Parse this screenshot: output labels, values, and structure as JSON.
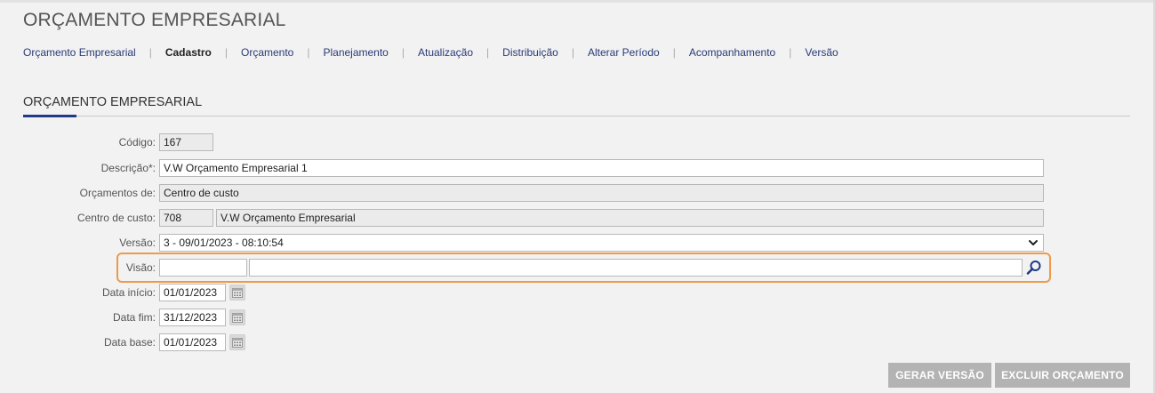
{
  "app": {
    "title": "ORÇAMENTO EMPRESARIAL"
  },
  "menu": {
    "items": [
      {
        "label": "Orçamento Empresarial",
        "active": false
      },
      {
        "label": "Cadastro",
        "active": true
      },
      {
        "label": "Orçamento",
        "active": false
      },
      {
        "label": "Planejamento",
        "active": false
      },
      {
        "label": "Atualização",
        "active": false
      },
      {
        "label": "Distribuição",
        "active": false
      },
      {
        "label": "Alterar Período",
        "active": false
      },
      {
        "label": "Acompanhamento",
        "active": false
      },
      {
        "label": "Versão",
        "active": false
      }
    ],
    "separator": "|"
  },
  "section": {
    "title": "ORÇAMENTO EMPRESARIAL"
  },
  "form": {
    "codigo": {
      "label": "Código:",
      "value": "167"
    },
    "descricao": {
      "label": "Descrição*:",
      "value": "V.W Orçamento Empresarial 1"
    },
    "orcamentos_de": {
      "label": "Orçamentos de:",
      "value": "Centro de custo"
    },
    "centro_custo": {
      "label": "Centro de custo:",
      "code": "708",
      "name": "V.W Orçamento Empresarial"
    },
    "versao": {
      "label": "Versão:",
      "value": "3 - 09/01/2023 - 08:10:54"
    },
    "visao": {
      "label": "Visão:",
      "code": "",
      "name": ""
    },
    "data_inicio": {
      "label": "Data início:",
      "value": "01/01/2023"
    },
    "data_fim": {
      "label": "Data fim:",
      "value": "31/12/2023"
    },
    "data_base": {
      "label": "Data base:",
      "value": "01/01/2023"
    }
  },
  "buttons": {
    "gerar_versao": "GERAR VERSÃO",
    "excluir_orcamento": "EXCLUIR ORÇAMENTO"
  },
  "colors": {
    "accent": "#1f3b87",
    "menu_link": "#2a3a78",
    "highlight": "#ef9a4a",
    "button_disabled": "#b3b3b3"
  },
  "icons": {
    "search": "magnifier-icon",
    "calendar": "calendar-icon",
    "dropdown": "chevron-down-icon"
  }
}
